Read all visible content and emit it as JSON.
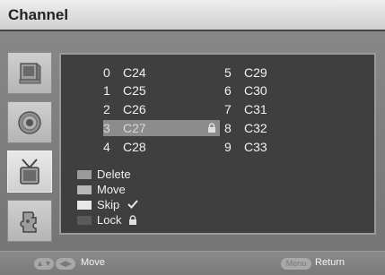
{
  "title": "Channel",
  "sidebar": {
    "items": [
      {
        "icon": "tv-monitor-icon"
      },
      {
        "icon": "speaker-icon"
      },
      {
        "icon": "antenna-tv-icon",
        "selected": true
      },
      {
        "icon": "puzzle-head-icon"
      }
    ]
  },
  "channels": {
    "left": [
      {
        "num": "0",
        "ch": "C24"
      },
      {
        "num": "1",
        "ch": "C25"
      },
      {
        "num": "2",
        "ch": "C26"
      },
      {
        "num": "3",
        "ch": "C27",
        "highlighted": true,
        "locked": true
      },
      {
        "num": "4",
        "ch": "C28"
      }
    ],
    "right": [
      {
        "num": "5",
        "ch": "C29"
      },
      {
        "num": "6",
        "ch": "C30"
      },
      {
        "num": "7",
        "ch": "C31"
      },
      {
        "num": "8",
        "ch": "C32"
      },
      {
        "num": "9",
        "ch": "C33"
      }
    ]
  },
  "legend": [
    {
      "label": "Delete",
      "color": "#9a9a9a"
    },
    {
      "label": "Move",
      "color": "#b8b8b8"
    },
    {
      "label": "Skip",
      "color": "#e8e8e8",
      "icon": "check-icon"
    },
    {
      "label": "Lock",
      "color": "#5a5a5a",
      "icon": "lock-icon"
    }
  ],
  "footer": {
    "move_label": "Move",
    "return_label": "Return",
    "menu_key": "Menu"
  }
}
